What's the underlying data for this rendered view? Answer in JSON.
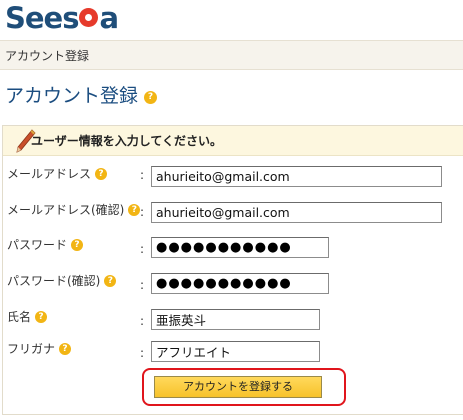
{
  "logo": {
    "text_before": "Sees",
    "text_after": "a"
  },
  "breadcrumb": "アカウント登録",
  "page_title": "アカウント登録",
  "panel": {
    "instruction": "ユーザー情報を入力してください。"
  },
  "form": {
    "colon": ":",
    "help_glyph": "?",
    "email": {
      "label": "メールアドレス",
      "value": "ahurieito@gmail.com"
    },
    "email_confirm": {
      "label": "メールアドレス(確認)",
      "value": "ahurieito@gmail.com"
    },
    "password": {
      "label": "パスワード",
      "value": "●●●●●●●●●●●"
    },
    "password_confirm": {
      "label": "パスワード(確認)",
      "value": "●●●●●●●●●●●"
    },
    "name": {
      "label": "氏名",
      "value": "亜振英斗"
    },
    "furigana": {
      "label": "フリガナ",
      "value": "アフリエイト"
    },
    "submit_label": "アカウントを登録する"
  },
  "colors": {
    "accent_blue": "#1b4d80",
    "help_icon": "#f2b514",
    "submit_button": "#f7c22a",
    "highlight_ring": "#e0151c"
  },
  "icons": [
    "help-icon",
    "pencil-icon",
    "logo-dot-icon"
  ]
}
